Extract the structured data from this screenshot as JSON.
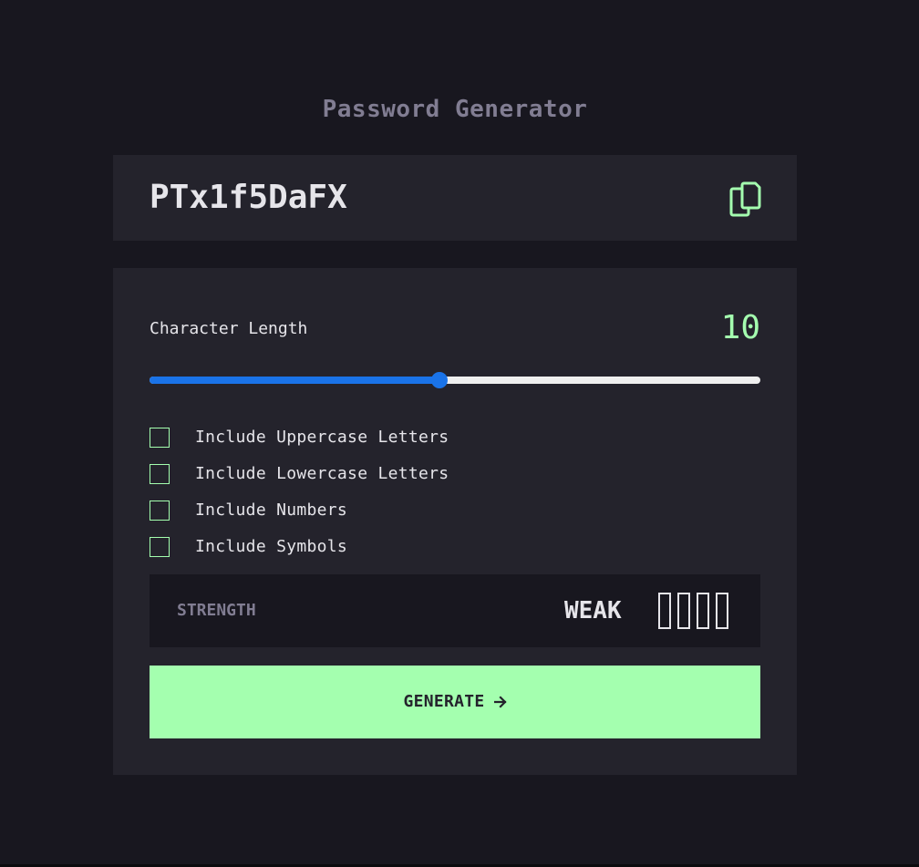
{
  "app": {
    "title": "Password Generator"
  },
  "password": {
    "value": "PTx1f5DaFX",
    "copy_icon": "copy-icon"
  },
  "length": {
    "label": "Character Length",
    "value": "10",
    "slider_fraction": 0.475
  },
  "options": [
    {
      "label": "Include Uppercase Letters",
      "checked": false
    },
    {
      "label": "Include Lowercase Letters",
      "checked": false
    },
    {
      "label": "Include Numbers",
      "checked": false
    },
    {
      "label": "Include Symbols",
      "checked": false
    }
  ],
  "strength": {
    "label": "STRENGTH",
    "value": "WEAK",
    "filled_bars": 0,
    "total_bars": 4
  },
  "generate": {
    "label": "GENERATE",
    "icon": "arrow-right-icon"
  },
  "colors": {
    "background": "#18171f",
    "card": "#24232c",
    "accent": "#a4ffaf",
    "slider": "#1a73e8",
    "muted_text": "#817d92",
    "text": "#e6e5ea"
  }
}
